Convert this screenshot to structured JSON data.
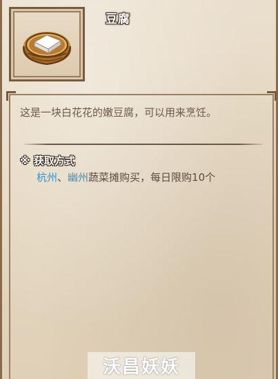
{
  "item": {
    "name": "豆腐",
    "icon": "tofu-in-wooden-bucket-icon",
    "description": "这是一块白花花的嫩豆腐，可以用来烹饪。"
  },
  "acquire": {
    "heading": "※ 获取方式",
    "location_1": "杭州",
    "separator": "、",
    "location_2": "幽州",
    "detail": "蔬菜摊购买，每日限购10个"
  },
  "watermark": {
    "text": "沃昌妖妖"
  },
  "colors": {
    "link": "#3f8fc4",
    "text": "#6b5848",
    "frame": "#7a5a3e"
  }
}
